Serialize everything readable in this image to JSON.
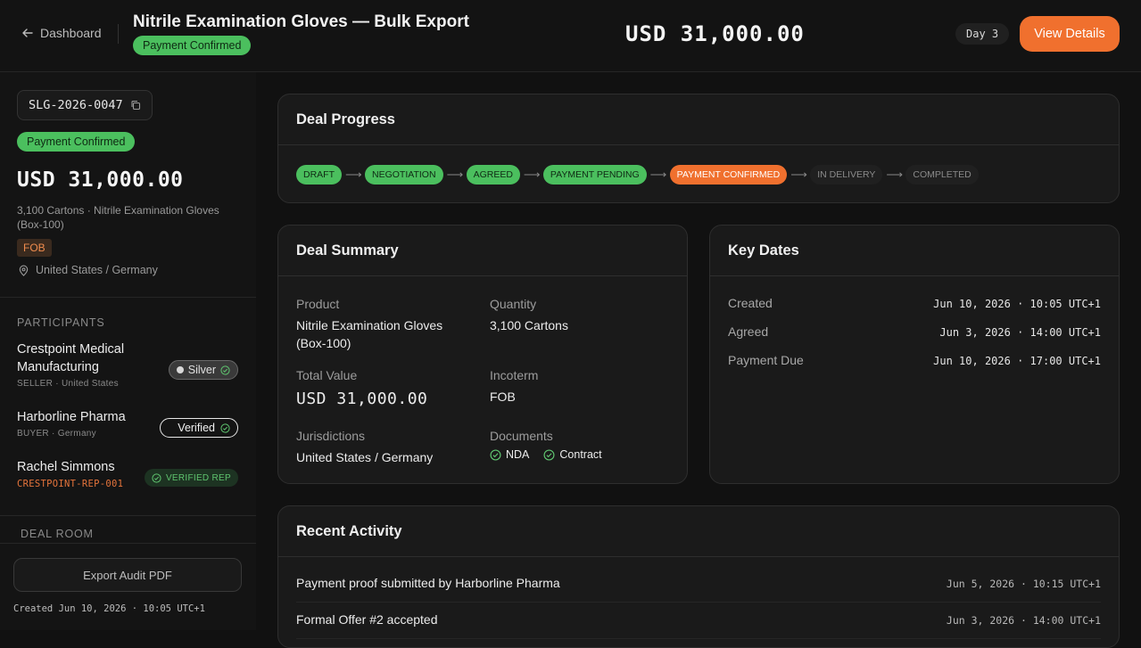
{
  "header": {
    "back_label": "Dashboard",
    "title": "Nitrile Examination Gloves — Bulk Export",
    "status_badge": "Payment Confirmed",
    "amount": "USD 31,000.00",
    "day_chip": "Day 3",
    "view_details_label": "View Details"
  },
  "sidebar": {
    "deal_id": "SLG-2026-0047",
    "status_badge": "Payment Confirmed",
    "amount": "USD 31,000.00",
    "description": "3,100 Cartons · Nitrile Examination Gloves (Box-100)",
    "incoterm_tag": "FOB",
    "location": "United States / Germany",
    "participants_label": "PARTICIPANTS",
    "participants": [
      {
        "name": "Crestpoint Medical Manufacturing",
        "sub": "SELLER · United States",
        "badge": "Silver"
      },
      {
        "name": "Harborline Pharma",
        "sub": "BUYER · Germany",
        "badge": "Verified"
      },
      {
        "name": "Rachel Simmons",
        "sub": "CRESTPOINT-REP-001",
        "badge": "VERIFIED REP"
      }
    ],
    "deal_room_label": "DEAL ROOM",
    "export_label": "Export Audit PDF",
    "created_text": "Created Jun 10, 2026 · 10:05 UTC+1"
  },
  "progress": {
    "title": "Deal Progress",
    "stages": [
      {
        "label": "DRAFT",
        "state": "done"
      },
      {
        "label": "NEGOTIATION",
        "state": "done"
      },
      {
        "label": "AGREED",
        "state": "done"
      },
      {
        "label": "PAYMENT PENDING",
        "state": "done"
      },
      {
        "label": "PAYMENT CONFIRMED",
        "state": "current"
      },
      {
        "label": "IN DELIVERY",
        "state": "todo"
      },
      {
        "label": "COMPLETED",
        "state": "todo"
      }
    ]
  },
  "summary": {
    "title": "Deal Summary",
    "product_label": "Product",
    "product_value": "Nitrile Examination Gloves (Box-100)",
    "quantity_label": "Quantity",
    "quantity_value": "3,100 Cartons",
    "total_label": "Total Value",
    "total_value": "USD 31,000.00",
    "incoterm_label": "Incoterm",
    "incoterm_value": "FOB",
    "jurisdictions_label": "Jurisdictions",
    "jurisdictions_value": "United States / Germany",
    "documents_label": "Documents",
    "documents": [
      "NDA",
      "Contract"
    ]
  },
  "key_dates": {
    "title": "Key Dates",
    "rows": [
      {
        "label": "Created",
        "value": "Jun 10, 2026 · 10:05 UTC+1"
      },
      {
        "label": "Agreed",
        "value": "Jun 3, 2026 · 14:00 UTC+1"
      },
      {
        "label": "Payment Due",
        "value": "Jun 10, 2026 · 17:00 UTC+1"
      }
    ]
  },
  "activity": {
    "title": "Recent Activity",
    "rows": [
      {
        "text": "Payment proof submitted by Harborline Pharma",
        "time": "Jun 5, 2026 · 10:15 UTC+1"
      },
      {
        "text": "Formal Offer #2 accepted",
        "time": "Jun 3, 2026 · 14:00 UTC+1"
      }
    ]
  },
  "colors": {
    "accent": "#f0702e",
    "success": "#4bbf5e",
    "background": "#111111"
  }
}
